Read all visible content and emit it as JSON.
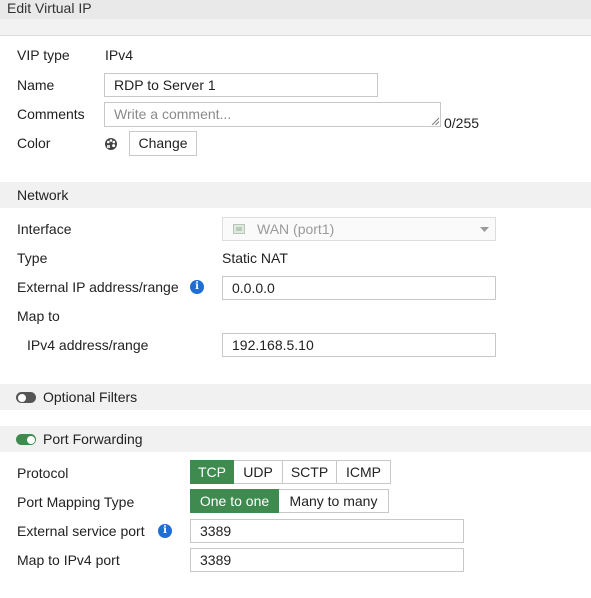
{
  "window": {
    "title": "Edit Virtual IP"
  },
  "fields": {
    "vip_type": {
      "label": "VIP type",
      "value": "IPv4"
    },
    "name": {
      "label": "Name",
      "value": "RDP to Server 1"
    },
    "comments": {
      "label": "Comments",
      "placeholder": "Write a comment...",
      "counter": "0/255"
    },
    "color": {
      "label": "Color",
      "change_label": "Change",
      "icon": "palette-icon"
    }
  },
  "network": {
    "section_title": "Network",
    "interface": {
      "label": "Interface",
      "value": "WAN (port1)",
      "icon": "network-port-icon"
    },
    "type": {
      "label": "Type",
      "value": "Static NAT"
    },
    "external_ip": {
      "label": "External IP address/range",
      "value": "0.0.0.0"
    },
    "map_to": {
      "label": "Map to"
    },
    "ipv4_range": {
      "label": "IPv4 address/range",
      "value": "192.168.5.10"
    }
  },
  "optional_filters": {
    "label": "Optional Filters",
    "enabled": false
  },
  "port_forwarding": {
    "label": "Port Forwarding",
    "enabled": true,
    "protocol": {
      "label": "Protocol",
      "options": [
        "TCP",
        "UDP",
        "SCTP",
        "ICMP"
      ],
      "selected": "TCP"
    },
    "port_mapping_type": {
      "label": "Port Mapping Type",
      "options": [
        "One to one",
        "Many to many"
      ],
      "selected": "One to one"
    },
    "external_service_port": {
      "label": "External service port",
      "value": "3389"
    },
    "map_to_ipv4_port": {
      "label": "Map to IPv4 port",
      "value": "3389"
    }
  },
  "colors": {
    "accent_green": "#3f8a4f",
    "toggle_off": "#555555",
    "info_blue": "#1f6ed4"
  }
}
